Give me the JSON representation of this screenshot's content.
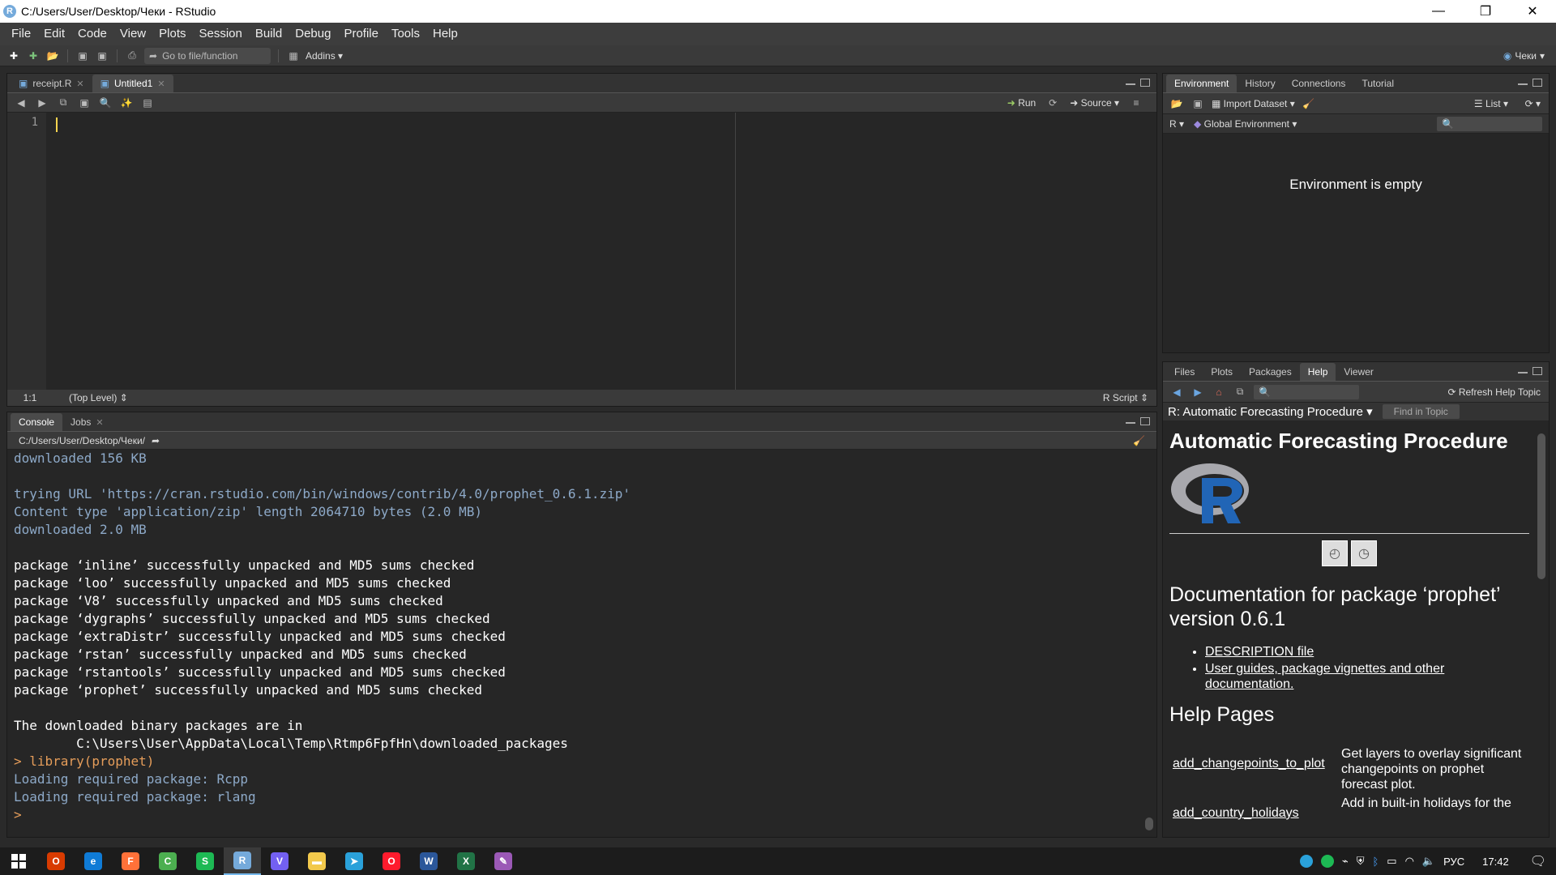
{
  "window": {
    "title": "C:/Users/User/Desktop/Чеки - RStudio",
    "min_glyph": "—",
    "max_glyph": "❐",
    "close_glyph": "✕"
  },
  "menu": [
    "File",
    "Edit",
    "Code",
    "View",
    "Plots",
    "Session",
    "Build",
    "Debug",
    "Profile",
    "Tools",
    "Help"
  ],
  "toolbar": {
    "goto_placeholder": "Go to file/function",
    "addins_label": "Addins",
    "project_label": "Чеки"
  },
  "editor": {
    "tabs": [
      {
        "label": "receipt.R",
        "active": false
      },
      {
        "label": "Untitled1",
        "active": true
      }
    ],
    "run_label": "Run",
    "source_label": "Source",
    "line_number": "1",
    "cursor_pos": "1:1",
    "scope": "(Top Level)",
    "file_type": "R Script"
  },
  "console": {
    "tabs": [
      {
        "label": "Console",
        "active": true
      },
      {
        "label": "Jobs",
        "active": false
      }
    ],
    "path": "C:/Users/User/Desktop/Чеки/",
    "lines": [
      {
        "t": "info",
        "s": "downloaded 156 KB"
      },
      {
        "t": "blank",
        "s": ""
      },
      {
        "t": "info",
        "s": "trying URL 'https://cran.rstudio.com/bin/windows/contrib/4.0/prophet_0.6.1.zip'"
      },
      {
        "t": "info",
        "s": "Content type 'application/zip' length 2064710 bytes (2.0 MB)"
      },
      {
        "t": "info",
        "s": "downloaded 2.0 MB"
      },
      {
        "t": "blank",
        "s": ""
      },
      {
        "t": "msg",
        "s": "package ‘inline’ successfully unpacked and MD5 sums checked"
      },
      {
        "t": "msg",
        "s": "package ‘loo’ successfully unpacked and MD5 sums checked"
      },
      {
        "t": "msg",
        "s": "package ‘V8’ successfully unpacked and MD5 sums checked"
      },
      {
        "t": "msg",
        "s": "package ‘dygraphs’ successfully unpacked and MD5 sums checked"
      },
      {
        "t": "msg",
        "s": "package ‘extraDistr’ successfully unpacked and MD5 sums checked"
      },
      {
        "t": "msg",
        "s": "package ‘rstan’ successfully unpacked and MD5 sums checked"
      },
      {
        "t": "msg",
        "s": "package ‘rstantools’ successfully unpacked and MD5 sums checked"
      },
      {
        "t": "msg",
        "s": "package ‘prophet’ successfully unpacked and MD5 sums checked"
      },
      {
        "t": "blank",
        "s": ""
      },
      {
        "t": "msg",
        "s": "The downloaded binary packages are in"
      },
      {
        "t": "msg",
        "s": "\tC:\\Users\\User\\AppData\\Local\\Temp\\Rtmp6FpfHn\\downloaded_packages"
      },
      {
        "t": "cmd",
        "s": "> library(prophet)"
      },
      {
        "t": "info",
        "s": "Loading required package: Rcpp"
      },
      {
        "t": "info",
        "s": "Loading required package: rlang"
      },
      {
        "t": "cmd",
        "s": "> "
      }
    ]
  },
  "environment": {
    "tabs": [
      {
        "label": "Environment",
        "active": true
      },
      {
        "label": "History",
        "active": false
      },
      {
        "label": "Connections",
        "active": false
      },
      {
        "label": "Tutorial",
        "active": false
      }
    ],
    "import_label": "Import Dataset",
    "list_label": "List",
    "lang_label": "R",
    "scope_label": "Global Environment",
    "empty_message": "Environment is empty"
  },
  "help": {
    "tabs": [
      {
        "label": "Files",
        "active": false
      },
      {
        "label": "Plots",
        "active": false
      },
      {
        "label": "Packages",
        "active": false
      },
      {
        "label": "Help",
        "active": true
      },
      {
        "label": "Viewer",
        "active": false
      }
    ],
    "refresh_label": "Refresh Help Topic",
    "topic_label": "R: Automatic Forecasting Procedure",
    "find_in_topic": "Find in Topic",
    "doc_title": "Automatic Forecasting Procedure",
    "pkg_heading": "Documentation for package ‘prophet’ version 0.6.1",
    "links": [
      "DESCRIPTION file",
      "User guides, package vignettes and other documentation."
    ],
    "help_pages_heading": "Help Pages",
    "entries": [
      {
        "fn": "add_changepoints_to_plot",
        "desc": "Get layers to overlay significant changepoints on prophet forecast plot."
      },
      {
        "fn": "add_country_holidays",
        "desc": "Add in built-in holidays for the"
      }
    ]
  },
  "taskbar": {
    "apps": [
      {
        "name": "office-icon",
        "color": "#d83b01",
        "glyph": "O"
      },
      {
        "name": "edge-icon",
        "color": "#0f7bd6",
        "glyph": "e"
      },
      {
        "name": "firefox-icon",
        "color": "#ff7139",
        "glyph": "F"
      },
      {
        "name": "chrome-icon",
        "color": "#4caf50",
        "glyph": "C"
      },
      {
        "name": "spotify-icon",
        "color": "#1db954",
        "glyph": "S"
      },
      {
        "name": "rstudio-icon",
        "color": "#75aadb",
        "glyph": "R"
      },
      {
        "name": "viber-icon",
        "color": "#7360f2",
        "glyph": "V"
      },
      {
        "name": "explorer-icon",
        "color": "#f2c94c",
        "glyph": "▬"
      },
      {
        "name": "telegram-icon",
        "color": "#2aa1da",
        "glyph": "➤"
      },
      {
        "name": "opera-icon",
        "color": "#ff1b2d",
        "glyph": "O"
      },
      {
        "name": "word-icon",
        "color": "#2b579a",
        "glyph": "W"
      },
      {
        "name": "excel-icon",
        "color": "#217346",
        "glyph": "X"
      },
      {
        "name": "paint-icon",
        "color": "#9b59b6",
        "glyph": "✎"
      }
    ],
    "lang": "РУС",
    "time": "17:42"
  }
}
